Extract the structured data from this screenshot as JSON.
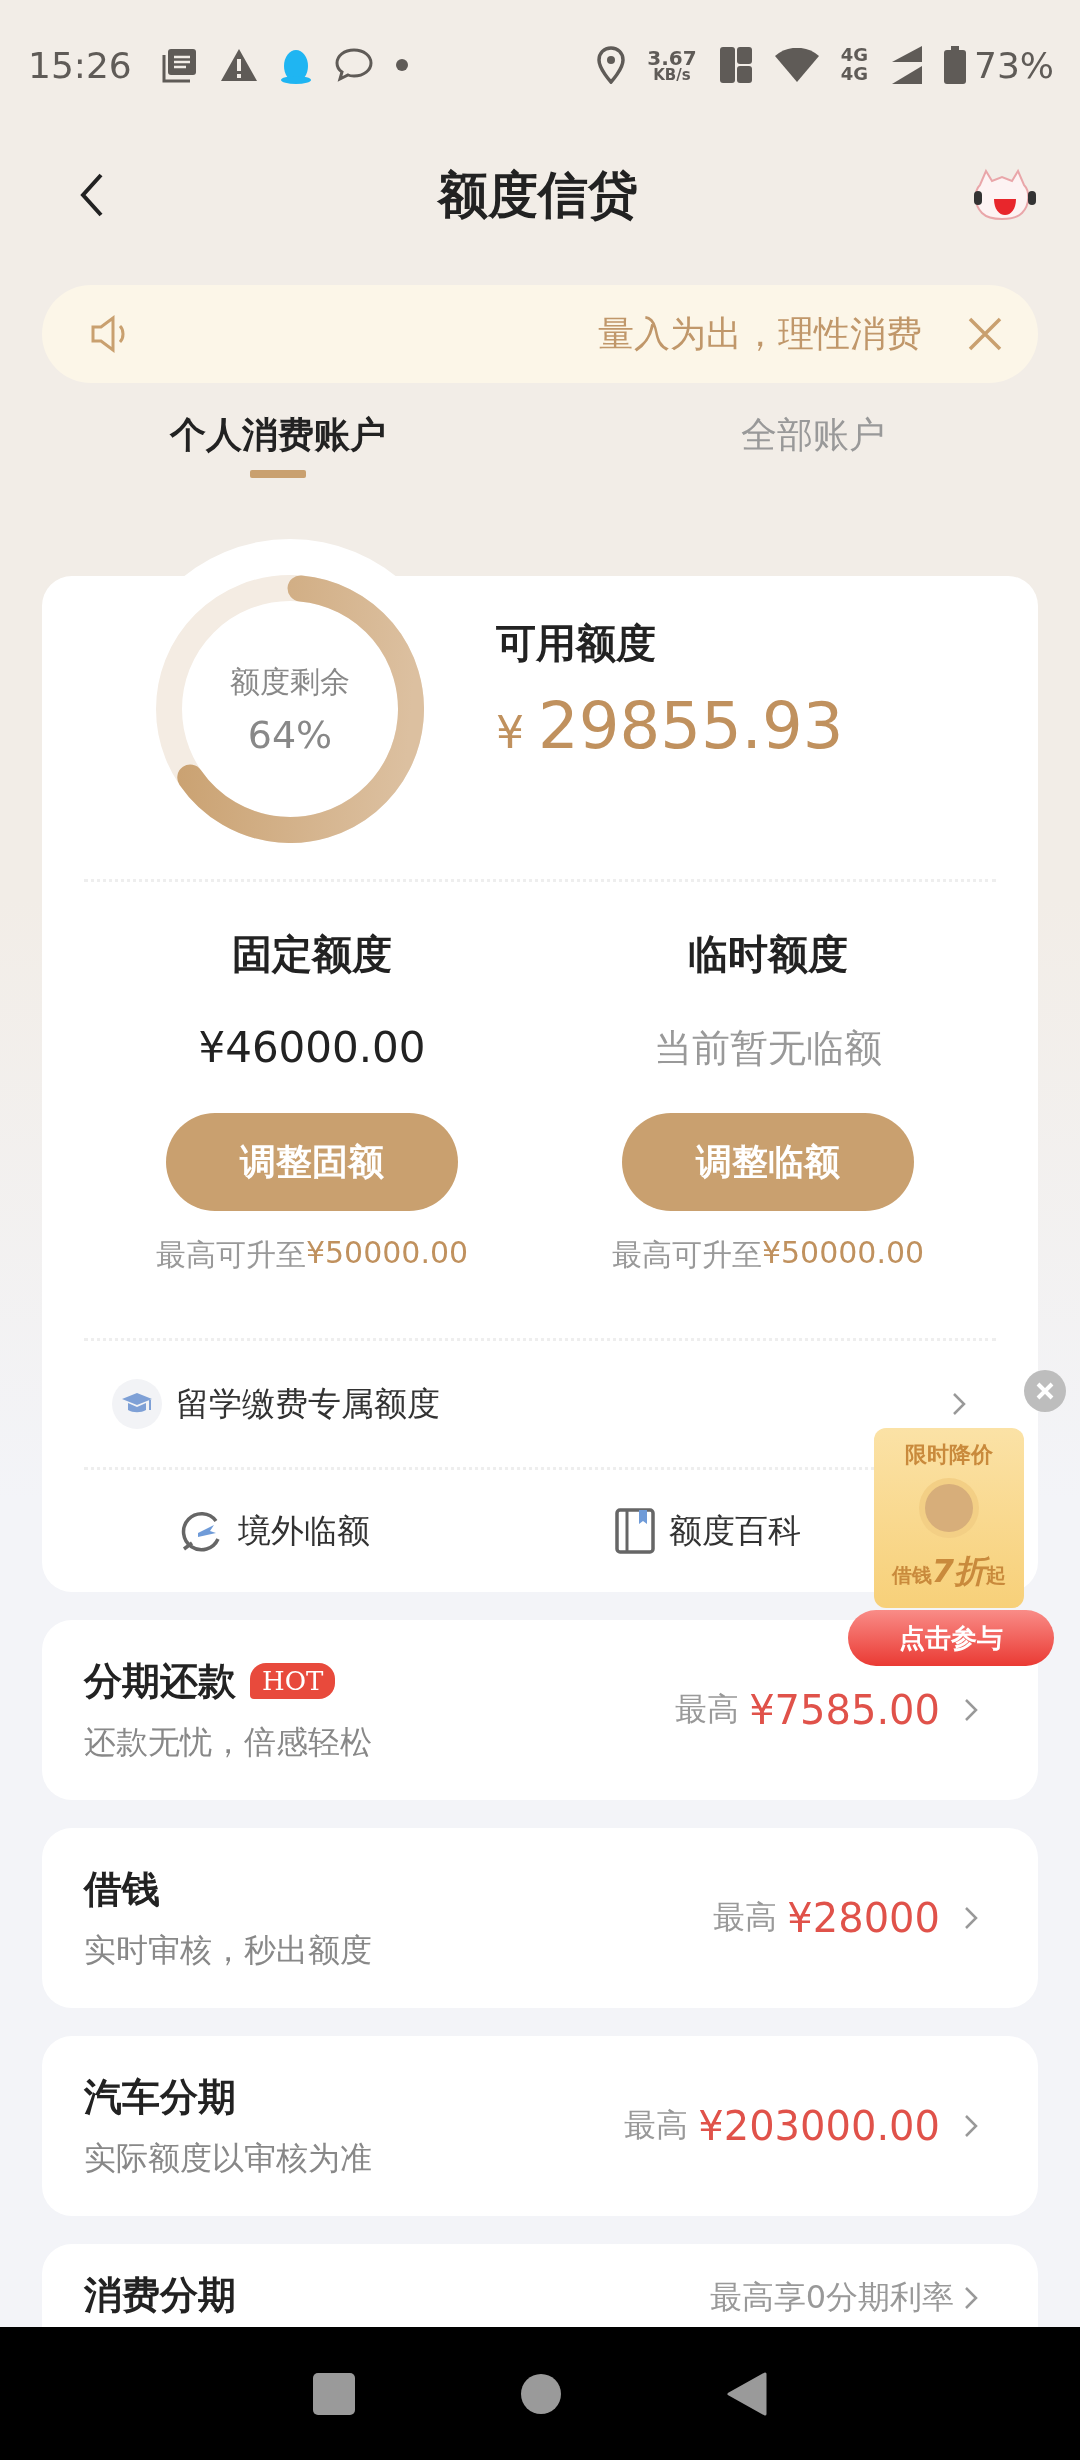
{
  "status_bar": {
    "time": "15:26",
    "net_speed": "3.67",
    "net_unit": "KB/s",
    "network": "4G",
    "network_2": "4G",
    "battery": "73%"
  },
  "header": {
    "title": "额度信贷"
  },
  "notice": {
    "text": "量入为出，理性消费"
  },
  "tabs": [
    {
      "label": "个人消费账户",
      "selected": true
    },
    {
      "label": "全部账户",
      "selected": false
    }
  ],
  "summary": {
    "ring_label": "额度剩余",
    "ring_percent": "64%",
    "available_label": "可用额度",
    "currency": "¥",
    "available_amount": "29855.93"
  },
  "quotas": [
    {
      "title": "固定额度",
      "value": "¥46000.00",
      "kind": "amount",
      "button": "调整固额",
      "hint": "最高可升至",
      "hint_amount": "¥50000.00"
    },
    {
      "title": "临时额度",
      "value": "当前暂无临额",
      "kind": "note",
      "button": "调整临额",
      "hint": "最高可升至",
      "hint_amount": "¥50000.00"
    }
  ],
  "study_link": {
    "label": "留学缴费专属额度"
  },
  "shortcuts": [
    {
      "label": "境外临额",
      "kind": "plane"
    },
    {
      "label": "额度百科",
      "kind": "book"
    }
  ],
  "products": [
    {
      "title": "分期还款",
      "badge": "HOT",
      "subtitle": "还款无忧，倍感轻松",
      "prefix": "最高",
      "amount": "¥7585.00"
    },
    {
      "title": "借钱",
      "subtitle": "实时审核，秒出额度",
      "prefix": "最高",
      "amount": "¥28000"
    },
    {
      "title": "汽车分期",
      "subtitle": "实际额度以审核为准",
      "prefix": "最高",
      "amount": "¥203000.00"
    },
    {
      "title": "消费分期",
      "prefix": "最高享0分期利率"
    }
  ],
  "promo": {
    "title": "限时降价",
    "offer": "借钱**7折**起",
    "button": "点击参与"
  }
}
